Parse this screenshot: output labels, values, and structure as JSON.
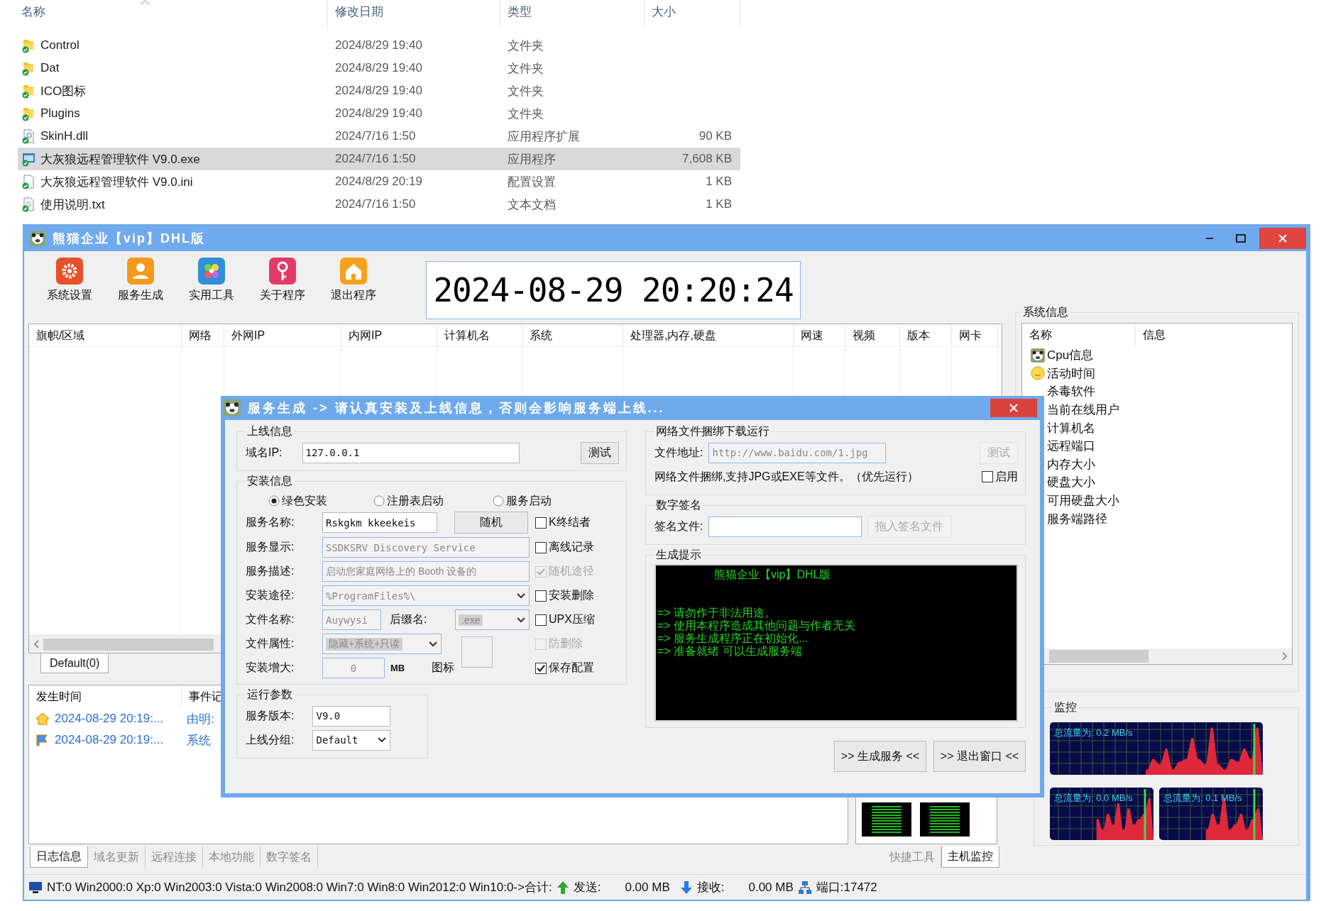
{
  "explorer": {
    "columns": [
      "名称",
      "修改日期",
      "类型",
      "大小"
    ],
    "rows": [
      {
        "name": "Control",
        "modified": "2024/8/29 19:40",
        "type": "文件夹",
        "kind": "folder",
        "selected": false
      },
      {
        "name": "Dat",
        "modified": "2024/8/29 19:40",
        "type": "文件夹",
        "kind": "folder",
        "selected": false
      },
      {
        "name": "ICO图标",
        "modified": "2024/8/29 19:40",
        "type": "文件夹",
        "kind": "folder",
        "selected": false
      },
      {
        "name": "Plugins",
        "modified": "2024/8/29 19:40",
        "type": "文件夹",
        "kind": "folder",
        "selected": false
      },
      {
        "name": "SkinH.dll",
        "modified": "2024/7/16 1:50",
        "type": "应用程序扩展",
        "size": "90 KB",
        "kind": "dll",
        "selected": false
      },
      {
        "name": "大灰狼远程管理软件 V9.0.exe",
        "modified": "2024/7/16 1:50",
        "type": "应用程序",
        "size": "7,608 KB",
        "kind": "exe",
        "selected": true
      },
      {
        "name": "大灰狼远程管理软件 V9.0.ini",
        "modified": "2024/8/29 20:19",
        "type": "配置设置",
        "size": "1 KB",
        "kind": "ini",
        "selected": false
      },
      {
        "name": "使用说明.txt",
        "modified": "2024/7/16 1:50",
        "type": "文本文档",
        "size": "1 KB",
        "kind": "txt",
        "selected": false
      }
    ]
  },
  "window": {
    "title": "熊猫企业【vip】DHL版"
  },
  "toolbar": [
    {
      "label": "系统设置",
      "kind": "settings"
    },
    {
      "label": "服务生成",
      "kind": "user"
    },
    {
      "label": "实用工具",
      "kind": "tools"
    },
    {
      "label": "关于程序",
      "kind": "about"
    },
    {
      "label": "退出程序",
      "kind": "exit"
    }
  ],
  "clock": "2024-08-29 20:20:24",
  "hosts_table": {
    "columns": [
      "旗帜/区域",
      "网络",
      "外网IP",
      "内网IP",
      "计算机名",
      "系统",
      "处理器,内存,硬盘",
      "网速",
      "视频",
      "版本",
      "网卡"
    ]
  },
  "host_group_tabs": [
    {
      "label": "Default(0)",
      "selected": true
    }
  ],
  "log": {
    "columns": [
      "发生时间",
      "事件记"
    ],
    "rows": [
      {
        "time": "2024-08-29 20:19:...",
        "event": "由明:",
        "kind": "home"
      },
      {
        "time": "2024-08-29 20:19:...",
        "event": "系统",
        "kind": "flag"
      }
    ]
  },
  "bottom_tabs": [
    {
      "label": "日志信息",
      "selected": true
    },
    {
      "label": "域名更新",
      "selected": false
    },
    {
      "label": "远程连接",
      "selected": false
    },
    {
      "label": "本地功能",
      "selected": false
    },
    {
      "label": "数字签名",
      "selected": false
    }
  ],
  "side_tabs": [
    {
      "label": "快捷工具",
      "selected": false
    },
    {
      "label": "主机监控",
      "selected": true
    }
  ],
  "status_bar": {
    "os_counts": "NT:0 Win2000:0 Xp:0 Win2003:0 Vista:0 Win2008:0 Win7:0 Win8:0 Win2012:0 Win10:0->合计:",
    "send_label": "发送:",
    "send_value": "0.00 MB",
    "recv_label": "接收:",
    "recv_value": "0.00 MB",
    "port": "端口:17472"
  },
  "system_info": {
    "title": "系统信息",
    "columns": [
      "名称",
      "信息"
    ],
    "rows": [
      {
        "name": "Cpu信息",
        "kind": "app"
      },
      {
        "name": "活动时间",
        "kind": "smiley"
      },
      {
        "name": "杀毒软件"
      },
      {
        "name": "当前在线用户"
      },
      {
        "name": "计算机名"
      },
      {
        "name": "远程端口"
      },
      {
        "name": "内存大小"
      },
      {
        "name": "硬盘大小"
      },
      {
        "name": "可用硬盘大小"
      },
      {
        "name": "服务端路径"
      }
    ]
  },
  "monitor": {
    "title": "监控",
    "graphs": [
      "总流量为: 0.2 MB/s",
      "总流量为: 0.0 MB/s",
      "总流量为: 0.1 MB/s"
    ]
  },
  "dialog": {
    "title": "服务生成 -> 请认真安装及上线信息，否则会影响服务端上线...",
    "online": {
      "title": "上线信息",
      "label": "域名IP:",
      "value": "127.0.0.1",
      "button": {
        "label": "测试",
        "disabled": false
      }
    },
    "install": {
      "title": "安装信息",
      "modes": [
        {
          "label": "绿色安装",
          "selected": true
        },
        {
          "label": "注册表启动",
          "selected": false
        },
        {
          "label": "服务启动",
          "selected": false
        }
      ],
      "service_name": {
        "label": "服务名称:",
        "value": "Rskgkm kkeekeis",
        "disabled": false
      },
      "random_button": "随机",
      "display": {
        "label": "服务显示:",
        "value": "SSDKSRV Discovery Service",
        "disabled": true
      },
      "description": {
        "label": "服务描述:",
        "value": "启动您家庭网络上的 Booth 设备的",
        "disabled": true
      },
      "path": {
        "label": "安装途径:",
        "value": "%ProgramFiles%\\",
        "disabled": true
      },
      "file_name": {
        "label": "文件名称:",
        "value": "Auywysi",
        "disabled": true
      },
      "suffix": {
        "label": "后缀名:",
        "value": ".exe",
        "disabled": true
      },
      "attributes": {
        "label": "文件属性:",
        "value": "隐藏+系统+只读",
        "disabled": true
      },
      "grow": {
        "label": "安装增大:",
        "value": "0",
        "unit": "MB",
        "disabled": true
      },
      "icon_label": "图标",
      "options": [
        {
          "label": "K终结者",
          "checked": false,
          "disabled": false
        },
        {
          "label": "离线记录",
          "checked": false,
          "disabled": false
        },
        {
          "label": "随机途径",
          "checked": true,
          "disabled": true
        },
        {
          "label": "安装删除",
          "checked": false,
          "disabled": false
        },
        {
          "label": "UPX压缩",
          "checked": false,
          "disabled": false
        },
        {
          "label": "防删除",
          "checked": false,
          "disabled": true
        },
        {
          "label": "保存配置",
          "checked": true,
          "disabled": false
        }
      ]
    },
    "runtime": {
      "title": "运行参数",
      "version_label": "服务版本:",
      "version": "V9.0",
      "group_label": "上线分组:",
      "group": "Default"
    },
    "bundle": {
      "title": "网络文件捆绑下载运行",
      "label": "文件地址:",
      "value": "http://www.baidu.com/1.jpg",
      "button": {
        "label": "测试",
        "disabled": true
      },
      "note": "网络文件捆绑,支持JPG或EXE等文件。（优先运行）",
      "enable": {
        "label": "启用",
        "checked": false
      }
    },
    "signature": {
      "title": "数字签名",
      "label": "签名文件:",
      "button": {
        "label": "拖入签名文件",
        "disabled": true
      }
    },
    "console": {
      "title": "生成提示",
      "heading": "熊猫企业【vip】DHL版",
      "lines": [
        "=> 请勿作于非法用途。",
        "=> 使用本程序造成其他问题与作者无关",
        "=> 服务生成程序正在初始化...",
        "=> 准备就绪 可以生成服务端"
      ]
    },
    "buttons": [
      ">> 生成服务 <<",
      ">> 退出窗口 <<"
    ]
  }
}
